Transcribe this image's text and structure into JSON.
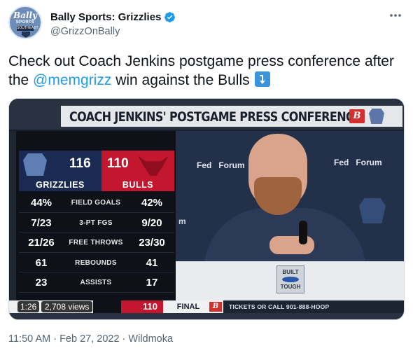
{
  "account": {
    "display_name": "Bally Sports: Grizzlies",
    "handle": "@GrizzOnBally",
    "avatar_text_top": "Bally",
    "avatar_text_mid": "SPORTS",
    "avatar_text_bot": "SOUTHEAST"
  },
  "tweet": {
    "text_part1": "Check out Coach Jenkins postgame press conference after the ",
    "mention": "@memgrizz",
    "text_part2": " win against the Bulls "
  },
  "video": {
    "banner_title": "COACH JENKINS' POSTGAME PRESS CONFERENCE",
    "bally_glyph": "B",
    "fedex_left": "Fed   Forum",
    "fedex_right": "Fed   Forum",
    "bg_text": "m",
    "built_top": "BUILT",
    "built_bottom": "TOUGH",
    "duration": "1:26",
    "views": "2,708 views",
    "ticker_score": "110",
    "ticker_final": "FINAL",
    "ticker_message": "TICKETS OR CALL 901-888-HOOP",
    "scoreboard": {
      "home_score": "116",
      "away_score": "110",
      "home_label": "GRIZZLIES",
      "away_label": "BULLS",
      "stats": [
        {
          "left": "44%",
          "label": "FIELD GOALS",
          "right": "42%"
        },
        {
          "left": "7/23",
          "label": "3-PT FGS",
          "right": "9/20"
        },
        {
          "left": "21/26",
          "label": "FREE THROWS",
          "right": "23/30"
        },
        {
          "left": "61",
          "label": "REBOUNDS",
          "right": "41"
        },
        {
          "left": "23",
          "label": "ASSISTS",
          "right": "17"
        }
      ]
    }
  },
  "meta": {
    "timestamp": "11:50 AM · Feb 27, 2022 · Wildmoka"
  },
  "colors": {
    "mention": "#1d9bf0",
    "grizzlies_navy": "#1b2a52",
    "bulls_red": "#c3172f",
    "verified": "#1d9bf0"
  },
  "icons": {
    "verified": "verified-badge-icon",
    "more": "more-options-icon",
    "arrow": "arrow-down-right-icon"
  }
}
